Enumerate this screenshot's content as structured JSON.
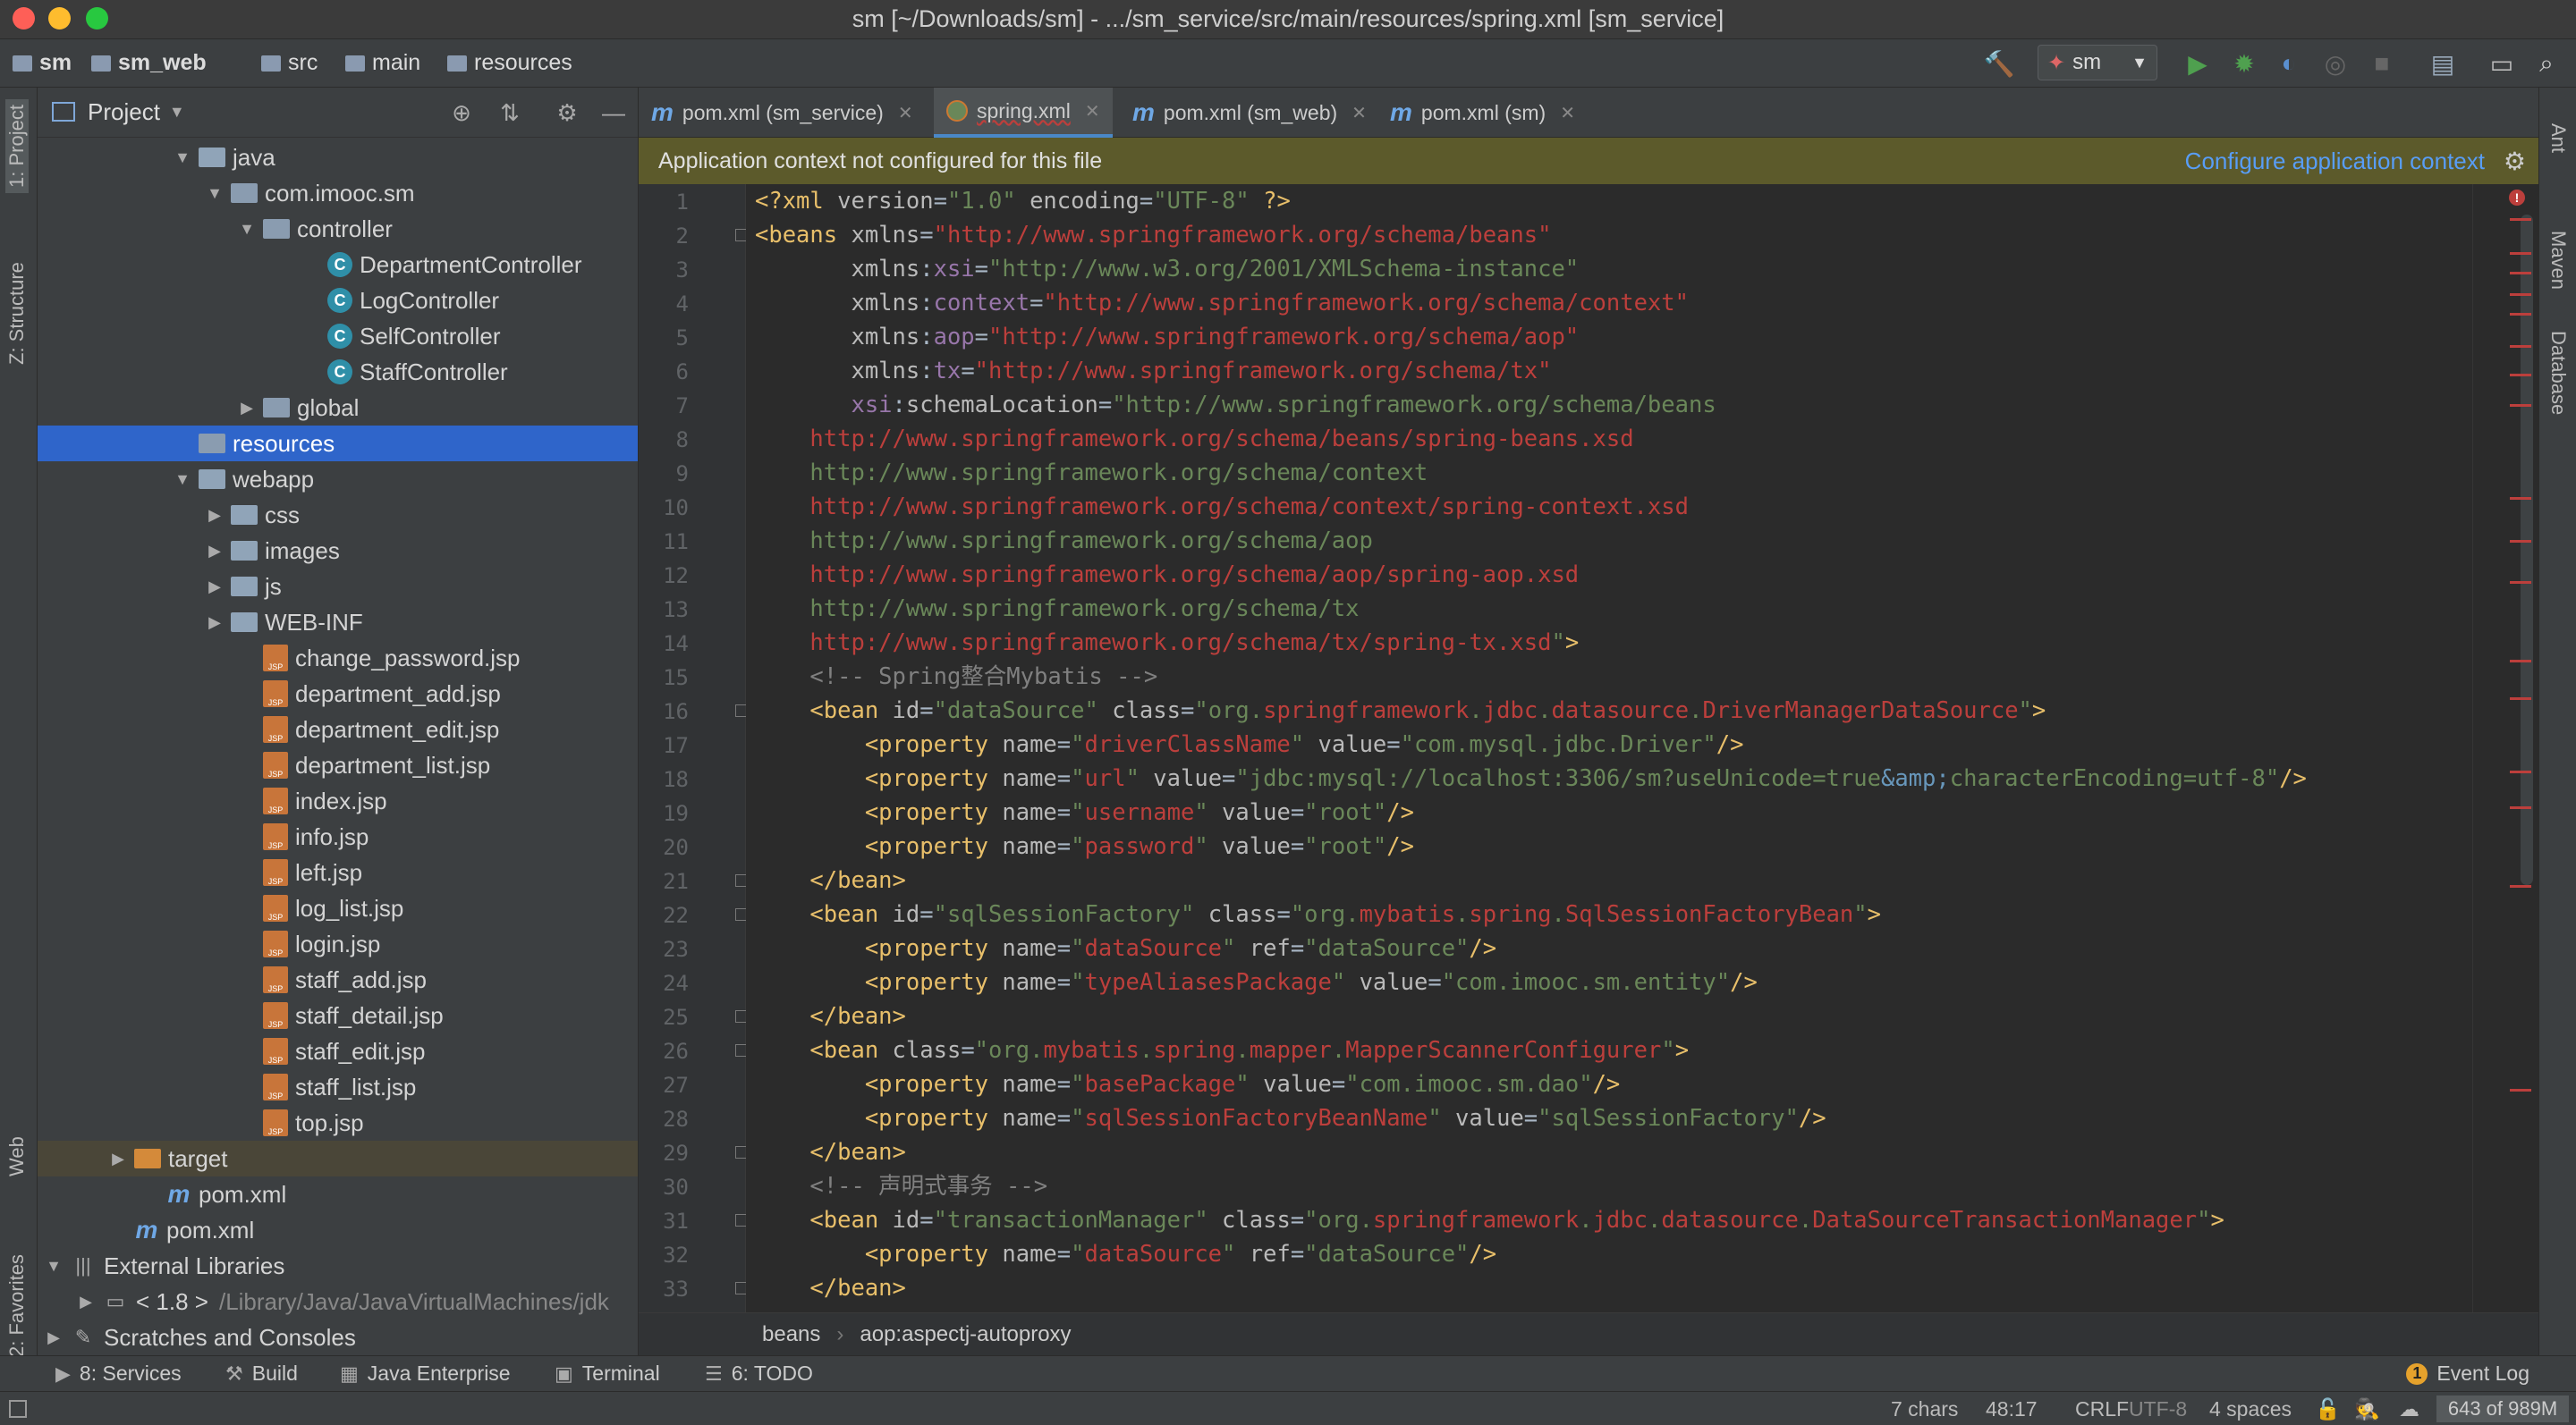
{
  "window": {
    "title": "sm [~/Downloads/sm] - .../sm_service/src/main/resources/spring.xml [sm_service]"
  },
  "breadcrumb": [
    "sm",
    "sm_web",
    "src",
    "main",
    "resources"
  ],
  "toolbar": {
    "run_config": "sm"
  },
  "left_tools": {
    "project": "1: Project",
    "structure": "Z: Structure",
    "web": "Web",
    "favorites": "2: Favorites"
  },
  "right_tools": {
    "ant": "Ant",
    "maven": "Maven",
    "database": "Database"
  },
  "project_panel": {
    "title": "Project",
    "rows": [
      {
        "label": "java",
        "kind": "folder",
        "depth": 4,
        "arrow": "▼"
      },
      {
        "label": "com.imooc.sm",
        "kind": "pkg",
        "depth": 5,
        "arrow": "▼"
      },
      {
        "label": "controller",
        "kind": "pkg",
        "depth": 6,
        "arrow": "▼"
      },
      {
        "label": "DepartmentController",
        "kind": "class",
        "depth": 8,
        "arrow": ""
      },
      {
        "label": "LogController",
        "kind": "class",
        "depth": 8,
        "arrow": ""
      },
      {
        "label": "SelfController",
        "kind": "class",
        "depth": 8,
        "arrow": ""
      },
      {
        "label": "StaffController",
        "kind": "class",
        "depth": 8,
        "arrow": ""
      },
      {
        "label": "global",
        "kind": "pkg",
        "depth": 6,
        "arrow": "▶"
      },
      {
        "label": "resources",
        "kind": "res",
        "depth": 4,
        "arrow": "",
        "selected": true
      },
      {
        "label": "webapp",
        "kind": "folder",
        "depth": 4,
        "arrow": "▼"
      },
      {
        "label": "css",
        "kind": "folder",
        "depth": 5,
        "arrow": "▶"
      },
      {
        "label": "images",
        "kind": "folder",
        "depth": 5,
        "arrow": "▶"
      },
      {
        "label": "js",
        "kind": "folder",
        "depth": 5,
        "arrow": "▶"
      },
      {
        "label": "WEB-INF",
        "kind": "folder",
        "depth": 5,
        "arrow": "▶"
      },
      {
        "label": "change_password.jsp",
        "kind": "jsp",
        "depth": 6,
        "arrow": ""
      },
      {
        "label": "department_add.jsp",
        "kind": "jsp",
        "depth": 6,
        "arrow": ""
      },
      {
        "label": "department_edit.jsp",
        "kind": "jsp",
        "depth": 6,
        "arrow": ""
      },
      {
        "label": "department_list.jsp",
        "kind": "jsp",
        "depth": 6,
        "arrow": ""
      },
      {
        "label": "index.jsp",
        "kind": "jsp",
        "depth": 6,
        "arrow": ""
      },
      {
        "label": "info.jsp",
        "kind": "jsp",
        "depth": 6,
        "arrow": ""
      },
      {
        "label": "left.jsp",
        "kind": "jsp",
        "depth": 6,
        "arrow": ""
      },
      {
        "label": "log_list.jsp",
        "kind": "jsp",
        "depth": 6,
        "arrow": ""
      },
      {
        "label": "login.jsp",
        "kind": "jsp",
        "depth": 6,
        "arrow": ""
      },
      {
        "label": "staff_add.jsp",
        "kind": "jsp",
        "depth": 6,
        "arrow": ""
      },
      {
        "label": "staff_detail.jsp",
        "kind": "jsp",
        "depth": 6,
        "arrow": ""
      },
      {
        "label": "staff_edit.jsp",
        "kind": "jsp",
        "depth": 6,
        "arrow": ""
      },
      {
        "label": "staff_list.jsp",
        "kind": "jsp",
        "depth": 6,
        "arrow": ""
      },
      {
        "label": "top.jsp",
        "kind": "jsp",
        "depth": 6,
        "arrow": ""
      },
      {
        "label": "target",
        "kind": "orange",
        "depth": 2,
        "arrow": "▶",
        "highlight": true
      },
      {
        "label": "pom.xml",
        "kind": "maven",
        "depth": 3,
        "arrow": ""
      },
      {
        "label": "pom.xml",
        "kind": "maven",
        "depth": 2,
        "arrow": ""
      },
      {
        "label": "External Libraries",
        "kind": "lib",
        "depth": 0,
        "arrow": "▼"
      },
      {
        "label": "< 1.8 >",
        "kind": "jdk",
        "depth": 1,
        "arrow": "▶",
        "extra": "/Library/Java/JavaVirtualMachines/jdk"
      },
      {
        "label": "Scratches and Consoles",
        "kind": "scratch",
        "depth": 0,
        "arrow": "▶"
      }
    ]
  },
  "tabs": [
    {
      "label": "pom.xml (sm_service)",
      "icon": "maven"
    },
    {
      "label": "spring.xml",
      "icon": "spring",
      "active": true
    },
    {
      "label": "pom.xml (sm_web)",
      "icon": "maven"
    },
    {
      "label": "pom.xml (sm)",
      "icon": "maven"
    }
  ],
  "banner": {
    "message": "Application context not configured for this file",
    "action": "Configure application context"
  },
  "code_lines": [
    "1",
    "2",
    "3",
    "4",
    "5",
    "6",
    "7",
    "8",
    "9",
    "10",
    "11",
    "12",
    "13",
    "14",
    "15",
    "16",
    "17",
    "18",
    "19",
    "20",
    "21",
    "22",
    "23",
    "24",
    "25",
    "26",
    "27",
    "28",
    "29",
    "30",
    "31",
    "32",
    "33"
  ],
  "editor_breadcrumb": [
    "beans",
    "aop:aspectj-autoproxy"
  ],
  "bottom_tools": {
    "services": "8: Services",
    "build": "Build",
    "java_enterprise": "Java Enterprise",
    "terminal": "Terminal",
    "todo": "6: TODO",
    "event_log": "Event Log",
    "event_count": "1"
  },
  "status": {
    "chars": "7 chars",
    "position": "48:17",
    "line_sep": "CRLF",
    "encoding": "UTF-8",
    "indent": "4 spaces",
    "memory": "643 of 989M"
  }
}
